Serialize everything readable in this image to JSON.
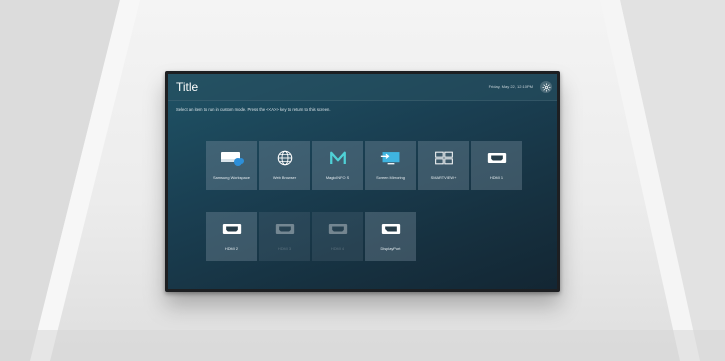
{
  "screen": {
    "title": "Title",
    "datetime": "Friday, May 22, 12:10PM",
    "instruction": "Select an item to run in custom mode. Press the <<A>> key to return to this screen."
  },
  "tiles": [
    {
      "label": "Samsung Workspace",
      "icon": "cloud-workspace-icon",
      "enabled": true
    },
    {
      "label": "Web Browser",
      "icon": "globe-icon",
      "enabled": true
    },
    {
      "label": "MagicINFO S",
      "icon": "magicinfo-logo-icon",
      "enabled": true
    },
    {
      "label": "Screen Mirroring",
      "icon": "screen-mirroring-icon",
      "enabled": true
    },
    {
      "label": "SMARTVIEW+",
      "icon": "grid-icon",
      "enabled": true
    },
    {
      "label": "HDMI 1",
      "icon": "hdmi-port-icon",
      "enabled": true
    },
    {
      "label": "HDMI 2",
      "icon": "hdmi-port-icon",
      "enabled": true
    },
    {
      "label": "HDMI 3",
      "icon": "hdmi-port-icon",
      "enabled": false
    },
    {
      "label": "HDMI 4",
      "icon": "hdmi-port-icon",
      "enabled": false
    },
    {
      "label": "DisplayPort",
      "icon": "displayport-icon",
      "enabled": true
    }
  ],
  "colors": {
    "accent": "#1f5366",
    "tile": "#8ca0af",
    "text": "#e6edf1"
  }
}
